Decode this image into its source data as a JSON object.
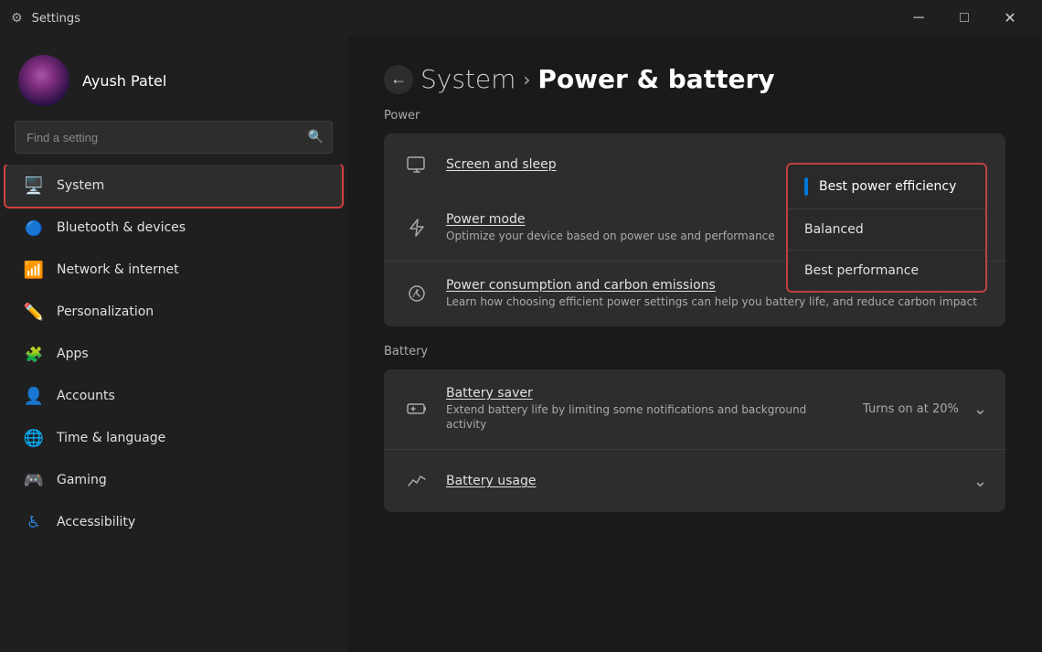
{
  "titlebar": {
    "title": "Settings",
    "min_label": "─",
    "max_label": "□",
    "close_label": "✕"
  },
  "user": {
    "name": "Ayush Patel"
  },
  "search": {
    "placeholder": "Find a setting"
  },
  "nav": {
    "items": [
      {
        "id": "system",
        "label": "System",
        "icon": "🖥️",
        "active": true
      },
      {
        "id": "bluetooth",
        "label": "Bluetooth & devices",
        "icon": "🔷"
      },
      {
        "id": "network",
        "label": "Network & internet",
        "icon": "📶"
      },
      {
        "id": "personalization",
        "label": "Personalization",
        "icon": "✏️"
      },
      {
        "id": "apps",
        "label": "Apps",
        "icon": "🧩"
      },
      {
        "id": "accounts",
        "label": "Accounts",
        "icon": "👤"
      },
      {
        "id": "time",
        "label": "Time & language",
        "icon": "🌐"
      },
      {
        "id": "gaming",
        "label": "Gaming",
        "icon": "🎮"
      },
      {
        "id": "accessibility",
        "label": "Accessibility",
        "icon": "♿"
      }
    ]
  },
  "breadcrumb": {
    "parent": "System",
    "chevron": "›",
    "current": "Power & battery"
  },
  "sections": {
    "power": {
      "title": "Power",
      "screen_sleep": {
        "label": "Screen and sleep",
        "icon": "🖥"
      },
      "power_mode": {
        "label": "Power mode",
        "underline": true,
        "desc": "Optimize your device based on power use and performance",
        "icon": "⚡"
      },
      "power_consumption": {
        "label": "Power consumption and carbon emissions",
        "desc": "Learn how choosing efficient power settings can help you battery life, and reduce carbon impact",
        "icon": "♻"
      }
    },
    "battery": {
      "title": "Battery",
      "battery_saver": {
        "label": "Battery saver",
        "desc": "Extend battery life by limiting some notifications and background activity",
        "icon": "🔋",
        "status": "Turns on at 20%"
      },
      "battery_usage": {
        "label": "Battery usage",
        "icon": "📈"
      }
    }
  },
  "power_mode_dropdown": {
    "options": [
      {
        "label": "Best power efficiency",
        "selected": true
      },
      {
        "label": "Balanced",
        "selected": false
      },
      {
        "label": "Best performance",
        "selected": false
      }
    ]
  }
}
